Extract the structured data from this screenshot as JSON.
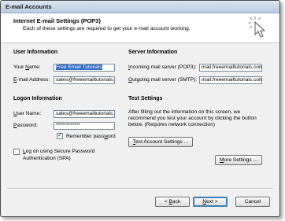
{
  "window": {
    "title": "E-mail Accounts"
  },
  "header": {
    "title": "Internet E-mail Settings (POP3)",
    "subtitle": "Each of these settings are required to get your e-mail account working."
  },
  "user_info": {
    "heading": "User Information",
    "name_label_pre": "Your ",
    "name_label_key": "N",
    "name_label_post": "ame:",
    "name_value": "Free Email Tutorials",
    "email_label_key": "E",
    "email_label_post": "-mail Address:",
    "email_value": "sales@freeemailtutorials.co"
  },
  "server_info": {
    "heading": "Server Information",
    "incoming_label_key": "I",
    "incoming_label_post": "ncoming mail server (POP3):",
    "incoming_value": "mail.freeemailtutorials.com",
    "outgoing_label_pre": "",
    "outgoing_label_key": "O",
    "outgoing_label_post": "utgoing mail server (SMTP):",
    "outgoing_value": "mail.freeemailtutorials.com"
  },
  "logon_info": {
    "heading": "Logon Information",
    "username_label_key": "U",
    "username_label_post": "ser Name:",
    "username_value": "sales@freeemailtutorials.co",
    "password_label_key": "P",
    "password_label_post": "assword:",
    "password_value": "************",
    "remember_label_pre": "Remember pass",
    "remember_label_key": "w",
    "remember_label_post": "ord",
    "remember_checked": true,
    "spa_label_key": "L",
    "spa_label_post": "og on using Secure Password",
    "spa_label_line2": "Authentication (SPA)",
    "spa_checked": false
  },
  "test_settings": {
    "heading": "Test Settings",
    "description": "After filling out the information on this screen, we recommend you test your account by clicking the button below. (Requires network connection)",
    "test_button_key": "T",
    "test_button_post": "est Account Settings ...",
    "more_button_key": "M",
    "more_button_post": "ore Settings ..."
  },
  "footer": {
    "back_pre": "< ",
    "back_key": "B",
    "back_post": "ack",
    "next_key": "N",
    "next_post": "ext >",
    "cancel_label": "Cancel"
  }
}
